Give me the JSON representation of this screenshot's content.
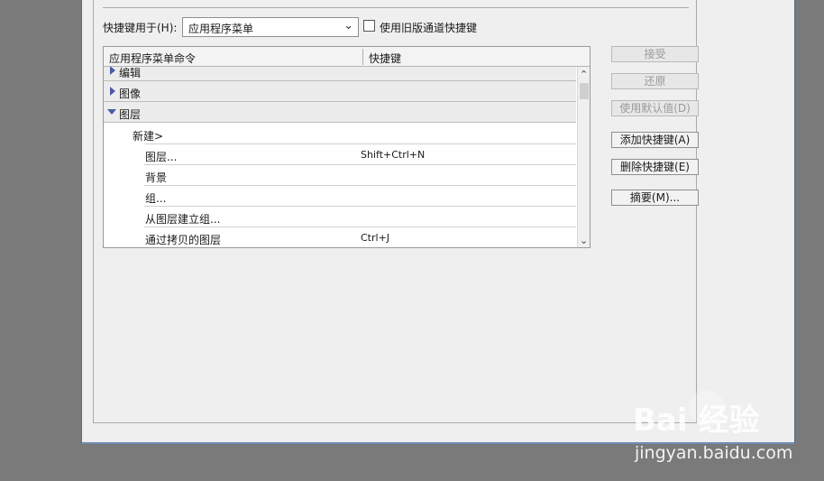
{
  "controls": {
    "shortcut_for_label": "快捷键用于(H):",
    "shortcut_for_value": "应用程序菜单",
    "legacy_label": "使用旧版通道快捷键"
  },
  "table": {
    "col_command": "应用程序菜单命令",
    "col_shortcut": "快捷键",
    "rows": [
      {
        "label": "编辑",
        "shortcut": ""
      },
      {
        "label": "图像",
        "shortcut": ""
      },
      {
        "label": "图层",
        "shortcut": ""
      },
      {
        "label": "新建>",
        "shortcut": ""
      },
      {
        "label": "图层...",
        "shortcut": "Shift+Ctrl+N"
      },
      {
        "label": "背景",
        "shortcut": ""
      },
      {
        "label": "组...",
        "shortcut": ""
      },
      {
        "label": "从图层建立组...",
        "shortcut": ""
      },
      {
        "label": "通过拷贝的图层",
        "shortcut": "Ctrl+J"
      }
    ]
  },
  "buttons": {
    "accept": "接受",
    "revert": "还原",
    "use_default": "使用默认值(D)",
    "add_shortcut": "添加快捷键(A)",
    "delete_shortcut": "删除快捷键(E)",
    "summary": "摘要(M)..."
  },
  "watermark": {
    "logo": "Bai  经验",
    "url": "jingyan.baidu.com"
  }
}
